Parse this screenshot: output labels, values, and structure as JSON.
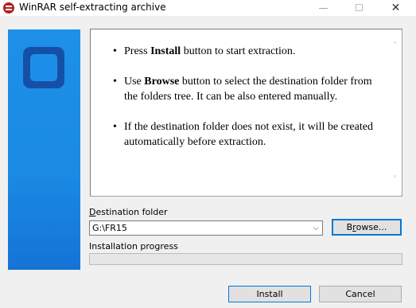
{
  "window": {
    "title": "WinRAR self-extracting archive",
    "controls": {
      "minimize": "—",
      "maximize": "☐",
      "close": "✕"
    }
  },
  "instructions": [
    {
      "pre": "Press ",
      "bold": "Install",
      "post": " button to start extraction."
    },
    {
      "pre": "Use ",
      "bold": "Browse",
      "post": " button to select the destination folder from the folders tree. It can be also entered manually."
    },
    {
      "pre": "",
      "bold": "",
      "post": "If the destination folder does not exist, it will be created automatically before extraction."
    }
  ],
  "destination": {
    "label_accel": "D",
    "label_rest": "estination folder",
    "value": "G:\\FR15"
  },
  "browse": {
    "label_pre": "B",
    "label_accel": "r",
    "label_post": "owse..."
  },
  "progress": {
    "label": "Installation progress",
    "fraction": 0
  },
  "buttons": {
    "install": "Install",
    "cancel": "Cancel"
  },
  "colors": {
    "panel_blue": "#1a8ae3",
    "focus_blue": "#0078d7",
    "logo_dark": "#1550a8"
  }
}
